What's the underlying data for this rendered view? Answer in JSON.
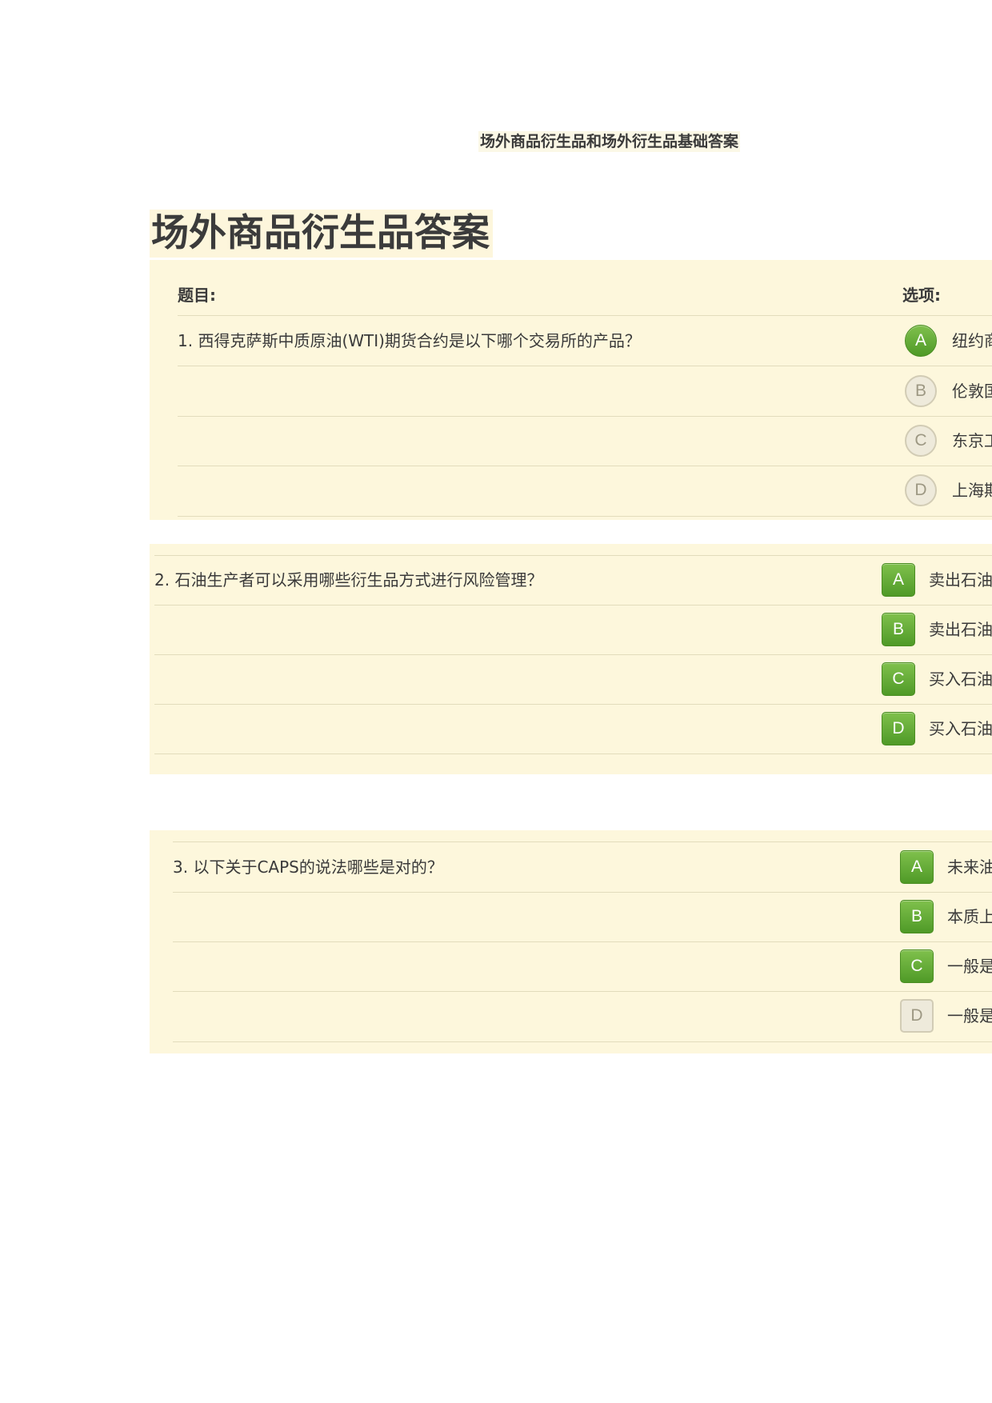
{
  "document": {
    "title": "场外商品衍生品和场外衍生品基础答案",
    "section_heading": "场外商品衍生品答案"
  },
  "table_header": {
    "question_label": "题目:",
    "options_label": "选项:"
  },
  "questions": [
    {
      "text": "1. 西得克萨斯中质原油(WTI)期货合约是以下哪个交易所的产品？",
      "options": [
        {
          "letter": "A",
          "text": "纽约商",
          "selected": true
        },
        {
          "letter": "B",
          "text": "伦敦国",
          "selected": false
        },
        {
          "letter": "C",
          "text": "东京工",
          "selected": false
        },
        {
          "letter": "D",
          "text": "上海期",
          "selected": false
        }
      ]
    },
    {
      "text": "2. 石油生产者可以采用哪些衍生品方式进行风险管理？",
      "options": [
        {
          "letter": "A",
          "text": "卖出石油",
          "selected": true
        },
        {
          "letter": "B",
          "text": "卖出石油",
          "selected": true
        },
        {
          "letter": "C",
          "text": "买入石油",
          "selected": true
        },
        {
          "letter": "D",
          "text": "买入石油",
          "selected": true
        }
      ]
    },
    {
      "text": "3. 以下关于CAPS的说法哪些是对的？",
      "options": [
        {
          "letter": "A",
          "text": "未来油",
          "selected": true
        },
        {
          "letter": "B",
          "text": "本质上",
          "selected": true
        },
        {
          "letter": "C",
          "text": "一般是",
          "selected": true
        },
        {
          "letter": "D",
          "text": "一般是",
          "selected": false
        }
      ]
    }
  ],
  "colors": {
    "selected_badge": "#5fa832",
    "unselected_badge": "#eeeadb",
    "block_background": "#fdf7dc"
  }
}
